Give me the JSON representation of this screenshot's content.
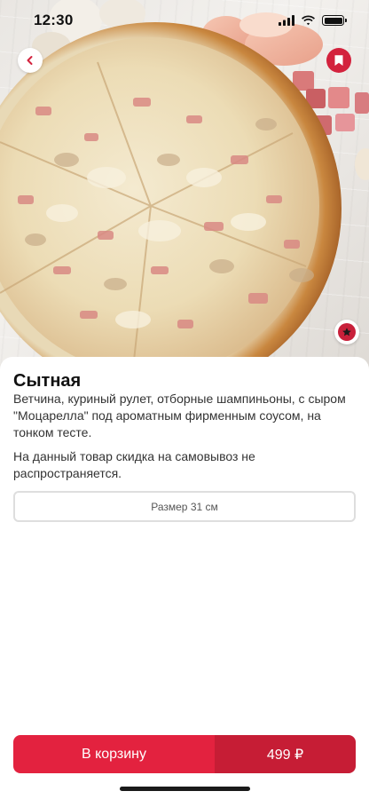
{
  "status_bar": {
    "time": "12:30",
    "icons": [
      "cellular-signal-icon",
      "wifi-icon",
      "battery-icon"
    ]
  },
  "hero": {
    "image": "pizza-photo",
    "back_icon": "chevron-left-icon",
    "bookmark_icon": "bookmark-icon",
    "badge_icon": "star-icon"
  },
  "product": {
    "title": "Сытная",
    "description": "Ветчина, куриный рулет, отборные шампиньоны, с сыром \"Моцарелла\" под ароматным фирменным соусом, на тонком тесте.",
    "notice": "На данный товар скидка на самовывоз не распространяется.",
    "size_label": "Размер 31 см"
  },
  "cta": {
    "label": "В корзину",
    "price": "499 ₽"
  },
  "colors": {
    "accent": "#e3223f",
    "accent_dark": "#c61d35",
    "text": "#111111",
    "border": "#dedede"
  }
}
